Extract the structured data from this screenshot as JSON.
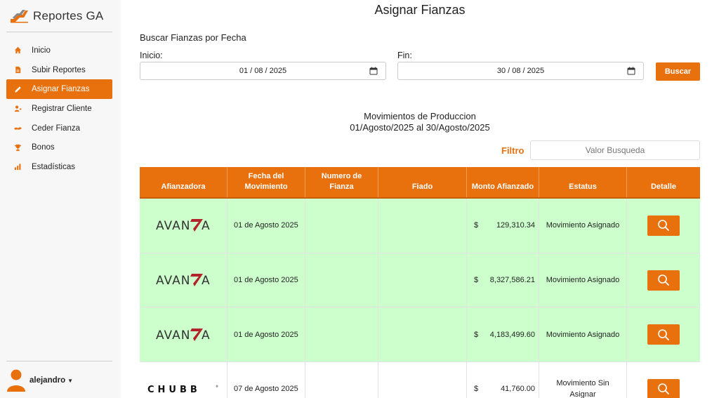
{
  "sidebar": {
    "brand": "Reportes GA",
    "items": [
      {
        "label": "Inicio",
        "icon": "home-icon"
      },
      {
        "label": "Subir Reportes",
        "icon": "file-icon"
      },
      {
        "label": "Asignar Fianzas",
        "icon": "pencil-icon"
      },
      {
        "label": "Registrar Cliente",
        "icon": "user-add-icon"
      },
      {
        "label": "Ceder Fianza",
        "icon": "handshake-icon"
      },
      {
        "label": "Bonos",
        "icon": "trophy-icon"
      },
      {
        "label": "Estadísticas",
        "icon": "bar-chart-icon"
      }
    ],
    "active_index": 2,
    "user": "alejandro"
  },
  "page": {
    "title": "Asignar Fianzas",
    "search_section": "Buscar Fianzas por Fecha",
    "start_label": "Inicio:",
    "start_value": "01 / 08 / 2025",
    "end_label": "Fin:",
    "end_value": "30 / 08 / 2025",
    "search_button": "Buscar"
  },
  "movements": {
    "title_line1": "Movimientos de Produccion",
    "title_line2": "01/Agosto/2025 al 30/Agosto/2025",
    "filter_label": "Filtro",
    "filter_placeholder": "Valor Busqueda"
  },
  "table": {
    "headers": {
      "afianzadora": "Afianzadora",
      "fecha_l1": "Fecha del",
      "fecha_l2": "Movimiento",
      "numero_l1": "Numero de",
      "numero_l2": "Fianza",
      "fiado": "Fiado",
      "monto": "Monto Afianzado",
      "estatus": "Estatus",
      "detalle": "Detalle"
    },
    "currency": "$",
    "rows": [
      {
        "logo": "AVANZA",
        "fecha": "01 de Agosto 2025",
        "numero": "",
        "fiado": "",
        "monto": "129,310.34",
        "estatus_l1": "Movimiento Asignado",
        "estatus_l2": ""
      },
      {
        "logo": "AVANZA",
        "fecha": "01 de Agosto 2025",
        "numero": "",
        "fiado": "",
        "monto": "8,327,586.21",
        "estatus_l1": "Movimiento Asignado",
        "estatus_l2": ""
      },
      {
        "logo": "AVANZA",
        "fecha": "01 de Agosto 2025",
        "numero": "",
        "fiado": "",
        "monto": "4,183,499.60",
        "estatus_l1": "Movimiento Asignado",
        "estatus_l2": ""
      },
      {
        "logo": "CHUBB",
        "fecha": "07 de Agosto 2025",
        "numero": "",
        "fiado": "",
        "monto": "41,760.00",
        "estatus_l1": "Movimiento Sin",
        "estatus_l2": "Asignar"
      }
    ]
  },
  "colors": {
    "accent": "#e8710e",
    "row_assigned": "#ccffcc",
    "sidebar_bg": "#f7f7f7"
  }
}
